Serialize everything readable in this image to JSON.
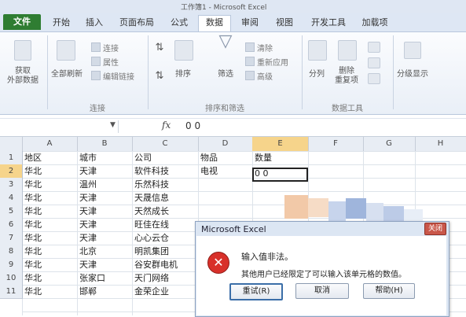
{
  "window": {
    "title": "工作簿1 - Microsoft Excel"
  },
  "tabs": [
    "文件",
    "开始",
    "插入",
    "页面布局",
    "公式",
    "数据",
    "审阅",
    "视图",
    "开发工具",
    "加载项"
  ],
  "ribbon": {
    "get_external_label": "获取\n外部数据",
    "refresh_all_label": "全部刷新",
    "connections_label": "连接",
    "properties_label": "属性",
    "edit_links_label": "编辑链接",
    "group_connections": "连接",
    "sort_label": "排序",
    "filter_label": "筛选",
    "clear_label": "清除",
    "reapply_label": "重新应用",
    "advanced_label": "高级",
    "group_sort_filter": "排序和筛选",
    "text_to_columns_label": "分列",
    "remove_duplicates_label": "删除\n重复项",
    "group_data_tools": "数据工具",
    "outline_label": "分级显示"
  },
  "formula_bar": {
    "fx": "fx",
    "value": "0 0"
  },
  "columns": [
    "A",
    "B",
    "C",
    "D",
    "E",
    "F",
    "G",
    "H"
  ],
  "rows": [
    "1",
    "2",
    "3",
    "4",
    "5",
    "6",
    "7",
    "8",
    "9",
    "10",
    "11"
  ],
  "cells": {
    "A": [
      "地区",
      "华北",
      "华北",
      "华北",
      "华北",
      "华北",
      "华北",
      "华北",
      "华北",
      "华北",
      "华北"
    ],
    "B": [
      "城市",
      "天津",
      "温州",
      "天津",
      "天津",
      "天津",
      "天津",
      "北京",
      "天津",
      "张家口",
      "邯郸"
    ],
    "C": [
      "公司",
      "软件科技",
      "乐然科技",
      "天晟信息",
      "天然成长",
      "旺佳在线",
      "心心云仓",
      "明凯集团",
      "谷安群电机",
      "天门网络",
      "金荣企业"
    ],
    "D1": "物品",
    "D2": "电视",
    "E1": "数量",
    "E2": "0 0"
  },
  "dialog": {
    "title": "Microsoft Excel",
    "close_label": "关闭",
    "message_main": "输入值非法。",
    "message_detail": "其他用户已经限定了可以输入该单元格的数值。",
    "retry_label": "重试(R)",
    "cancel_label": "取消",
    "help_label": "帮助(H)"
  },
  "colors": {
    "file_tab": "#2f7d32",
    "error_icon": "#d8302a",
    "dialog_bg": "#dce6f3"
  }
}
